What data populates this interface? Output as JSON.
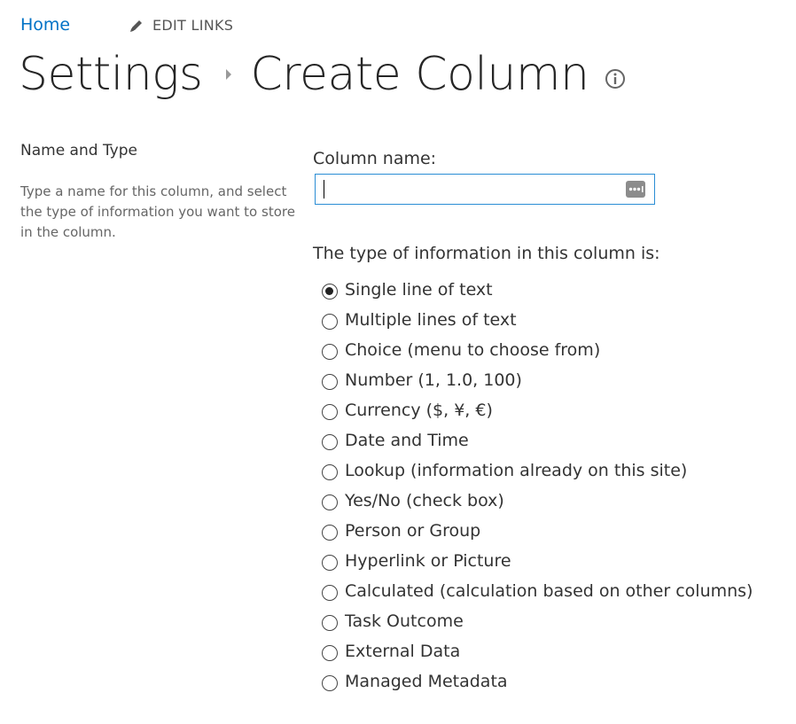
{
  "nav": {
    "home": "Home",
    "edit_links": "EDIT LINKS"
  },
  "breadcrumb": {
    "parent": "Settings",
    "current": "Create Column"
  },
  "section": {
    "title": "Name and Type",
    "description": "Type a name for this column, and select the type of information you want to store in the column."
  },
  "form": {
    "column_name_label": "Column name:",
    "column_name_value": "",
    "type_label": "The type of information in this column is:",
    "selected_index": 0,
    "types": [
      {
        "label": "Single line of text"
      },
      {
        "label": "Multiple lines of text"
      },
      {
        "label": "Choice (menu to choose from)"
      },
      {
        "label": "Number (1, 1.0, 100)"
      },
      {
        "label": "Currency ($, ¥, €)"
      },
      {
        "label": "Date and Time"
      },
      {
        "label": "Lookup (information already on this site)"
      },
      {
        "label": "Yes/No (check box)"
      },
      {
        "label": "Person or Group"
      },
      {
        "label": "Hyperlink or Picture"
      },
      {
        "label": "Calculated (calculation based on other columns)"
      },
      {
        "label": "Task Outcome"
      },
      {
        "label": "External Data"
      },
      {
        "label": "Managed Metadata"
      }
    ]
  },
  "colors": {
    "link": "#0072c6",
    "input_border": "#2a8dd4"
  }
}
